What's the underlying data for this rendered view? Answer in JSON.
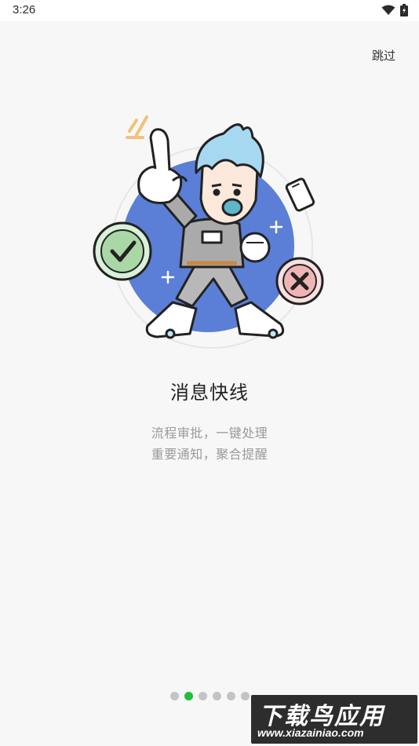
{
  "status_bar": {
    "time": "3:26",
    "wifi_icon": "wifi-icon",
    "battery_icon": "battery-charging-icon"
  },
  "skip_label": "跳过",
  "title": "消息快线",
  "description": {
    "line1": "流程审批，一键处理",
    "line2": "重要通知，聚合提醒"
  },
  "pager": {
    "total": 6,
    "active_index": 1
  },
  "watermark": {
    "title": "下载鸟应用",
    "url": "www.xiazainiao.com"
  },
  "colors": {
    "accent_green": "#1fbf3b",
    "illustration_blue": "#5b7fd6"
  }
}
